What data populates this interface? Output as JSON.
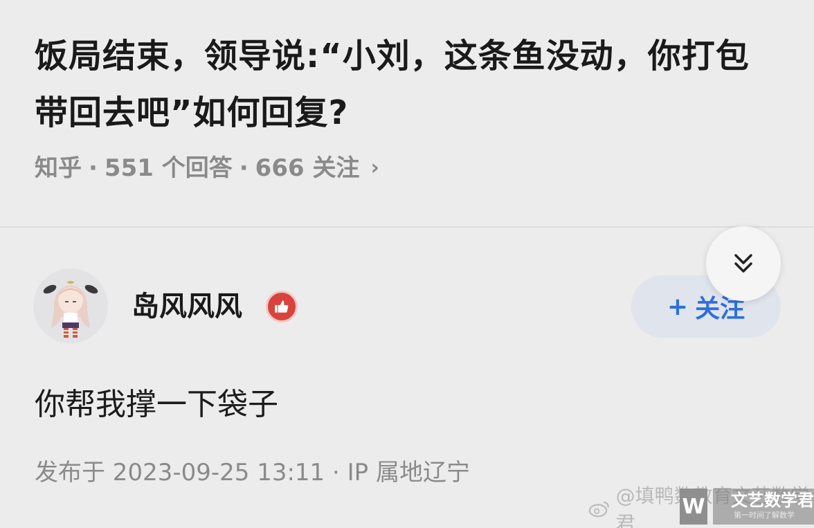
{
  "question": {
    "title": "饭局结束，领导说:“小刘，这条鱼没动，你打包带回去吧”如何回复?",
    "source": "知乎",
    "answers": "551 个回答",
    "followers": "666 关注",
    "chevron": "›"
  },
  "answer": {
    "author": "岛风风风",
    "follow_label": "关注",
    "follow_plus": "+",
    "content": "你帮我撑一下袋子",
    "publish_info": "发布于 2023-09-25 13:11 · IP 属地辽宁"
  },
  "watermark": {
    "handle": "@填鸭数教育文艺数学君",
    "brand": "文艺数学君",
    "brand_sub": "第一时间了解数学",
    "logo_letter": "W"
  },
  "colors": {
    "background": "#ececec",
    "accent": "#2e6fd8",
    "badge": "#d8433d",
    "meta_text": "#8a8a8a"
  },
  "icons": {
    "expand": "double-chevron-down-icon",
    "badge": "thumbs-up-icon",
    "watermark": "weibo-icon"
  }
}
